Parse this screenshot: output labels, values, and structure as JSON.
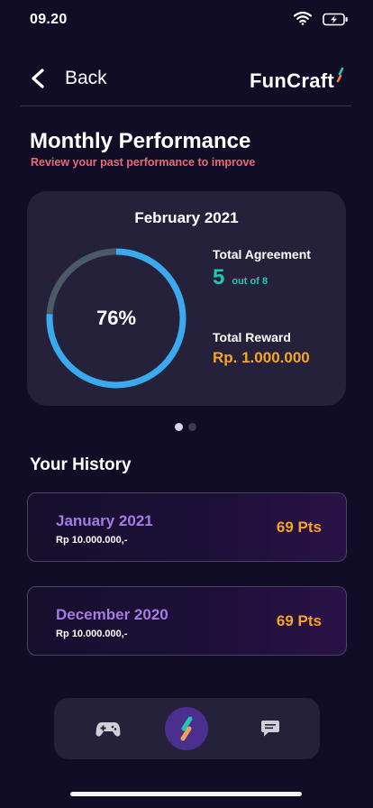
{
  "status_bar": {
    "time": "09.20"
  },
  "header": {
    "back_label": "Back",
    "brand_name": "FunCraft"
  },
  "page": {
    "title": "Monthly Performance",
    "subtitle": "Review your past performance to improve"
  },
  "performance_card": {
    "month": "February 2021",
    "progress_percent": 76,
    "progress_label": "76%",
    "agreement_label": "Total Agreement",
    "agreement_count": "5",
    "agreement_total": "out of 8",
    "reward_label": "Total Reward",
    "reward_value": "Rp. 1.000.000"
  },
  "pager": {
    "count": 2,
    "active_index": 0
  },
  "history": {
    "title": "Your History",
    "items": [
      {
        "month": "January 2021",
        "amount": "Rp 10.000.000,-",
        "points": "69 Pts"
      },
      {
        "month": "December 2020",
        "amount": "Rp 10.000.000,-",
        "points": "69 Pts"
      }
    ]
  },
  "bottom_nav": {
    "items": [
      "gamepad-icon",
      "funcraft-logo-icon",
      "chat-icon"
    ],
    "active": "funcraft-logo-icon"
  },
  "colors": {
    "background": "#120d26",
    "card": "#25213b",
    "accent_teal": "#1fc8b3",
    "accent_orange": "#f5a623",
    "accent_purple": "#a77be3",
    "subtitle_red": "#e96a77",
    "ring_fill": "#3aa9ee",
    "ring_track": "#4a5a66"
  }
}
